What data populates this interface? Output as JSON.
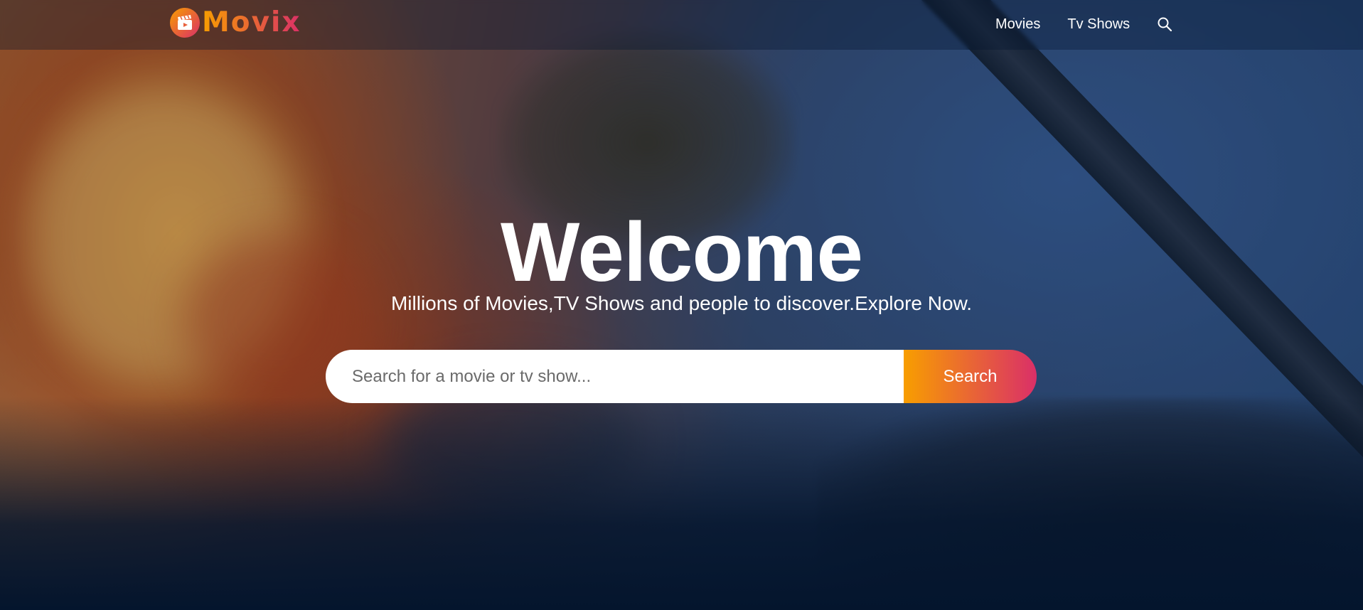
{
  "brand": {
    "name": "Movix",
    "accent_start": "#f89e00",
    "accent_end": "#da2f68",
    "background": "#04152d"
  },
  "nav": {
    "items": [
      {
        "label": "Movies",
        "icon": null
      },
      {
        "label": "Tv Shows",
        "icon": null
      }
    ],
    "search_icon": "search-icon"
  },
  "hero": {
    "title": "Welcome",
    "subtitle": "Millions of Movies,TV Shows and people to discover.Explore Now.",
    "search": {
      "placeholder": "Search for a movie or tv show...",
      "value": "",
      "button_label": "Search"
    }
  }
}
